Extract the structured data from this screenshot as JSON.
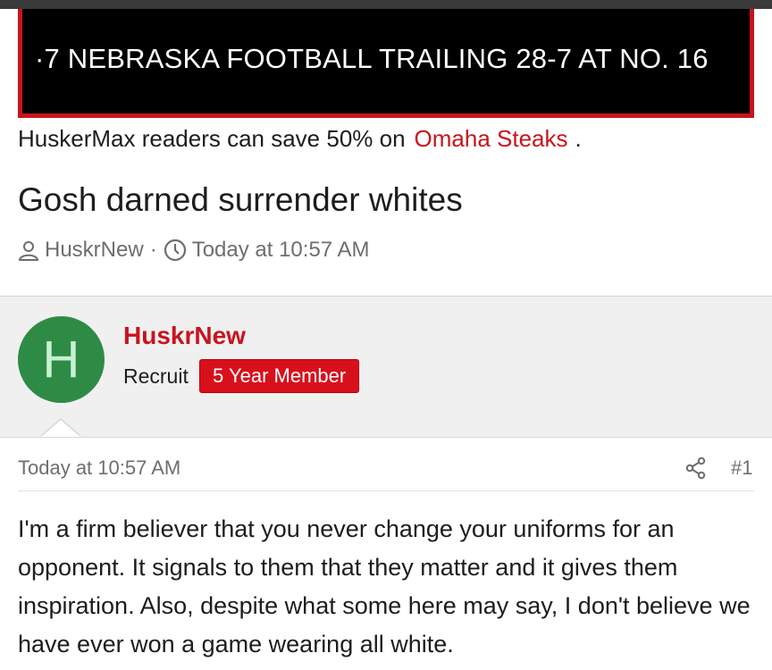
{
  "ticker": {
    "text": "·7   NEBRASKA FOOTBALL TRAILING 28-7 AT NO. 16"
  },
  "promo": {
    "prefix": "HuskerMax readers can save 50% on",
    "link": "Omaha Steaks",
    "suffix": "."
  },
  "thread": {
    "title": "Gosh darned surrender whites",
    "author": "HuskrNew",
    "separator": "·",
    "time": "Today at 10:57 AM"
  },
  "user": {
    "avatar_letter": "H",
    "name": "HuskrNew",
    "title": "Recruit",
    "badge": "5 Year Member"
  },
  "post": {
    "time": "Today at 10:57 AM",
    "number": "#1",
    "body": "I'm a firm believer that you never change your uniforms for an opponent. It signals to them that they matter and it gives them inspiration. Also, despite what some here may say, I don't believe we have ever won a game wearing all white."
  },
  "colors": {
    "accent": "#c8141e",
    "avatar_bg": "#2e8b45",
    "badge_bg": "#d8101c"
  },
  "icons": {
    "author": "user-icon",
    "time": "clock-icon",
    "share": "share-icon"
  }
}
